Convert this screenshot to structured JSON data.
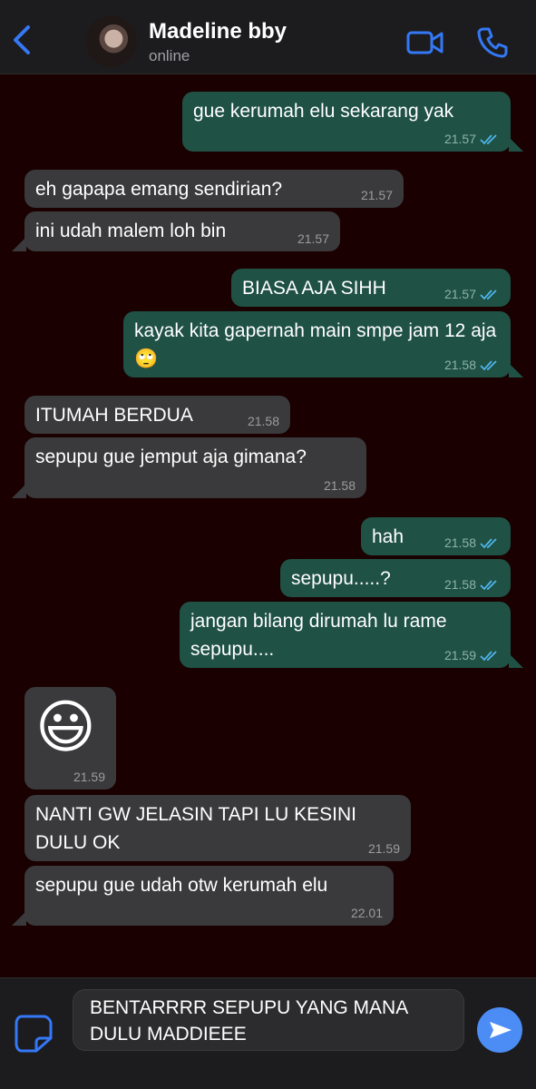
{
  "header": {
    "contact_name": "Madeline bby",
    "status": "online"
  },
  "colors": {
    "chat_background": "#1a0000",
    "incoming_bubble": "#3a3a3c",
    "outgoing_bubble": "#1f5145",
    "accent": "#3478f6",
    "read_ticks": "#4fb6ec"
  },
  "icons": {
    "back": "chevron-left-icon",
    "video": "video-camera-icon",
    "call": "phone-icon",
    "sticker": "sticker-icon",
    "send": "send-arrow-icon",
    "read_receipt": "double-check-icon"
  },
  "messages": [
    {
      "dir": "out",
      "text": "gue kerumah elu sekarang yak",
      "time": "21.57"
    },
    {
      "dir": "in",
      "text": "eh gapapa emang sendirian?",
      "time": "21.57"
    },
    {
      "dir": "in",
      "text": "ini udah malem loh bin",
      "time": "21.57"
    },
    {
      "dir": "out",
      "text": "BIASA AJA SIHH",
      "time": "21.57"
    },
    {
      "dir": "out",
      "text": "kayak kita gapernah main smpe jam 12 aja 🙄",
      "time": "21.58"
    },
    {
      "dir": "in",
      "text": "ITUMAH BERDUA",
      "time": "21.58"
    },
    {
      "dir": "in",
      "text": "sepupu gue jemput aja gimana?",
      "time": "21.58"
    },
    {
      "dir": "out",
      "text": "hah",
      "time": "21.58"
    },
    {
      "dir": "out",
      "text": "sepupu.....?",
      "time": "21.58"
    },
    {
      "dir": "out",
      "text": "jangan bilang dirumah lu rame sepupu....",
      "time": "21.59"
    },
    {
      "dir": "in",
      "text": "😃",
      "time": "21.59"
    },
    {
      "dir": "in",
      "text": "NANTI GW JELASIN TAPI LU KESINI DULU OK",
      "time": "21.59"
    },
    {
      "dir": "in",
      "text": "sepupu gue udah otw kerumah elu",
      "time": "22.01"
    }
  ],
  "composer": {
    "draft": "BENTARRRR SEPUPU YANG MANA DULU MADDIEEE"
  }
}
